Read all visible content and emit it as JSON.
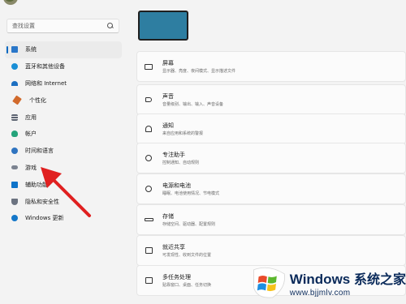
{
  "search": {
    "placeholder": "查找设置"
  },
  "sidebar": {
    "items": [
      {
        "label": "系统",
        "icon": "system-icon",
        "active": true
      },
      {
        "label": "蓝牙和其他设备",
        "icon": "bluetooth-icon"
      },
      {
        "label": "网络和 Internet",
        "icon": "wifi-icon"
      },
      {
        "label": "个性化",
        "icon": "brush-icon"
      },
      {
        "label": "应用",
        "icon": "apps-icon"
      },
      {
        "label": "帐户",
        "icon": "account-icon"
      },
      {
        "label": "时间和语言",
        "icon": "globe-clock-icon"
      },
      {
        "label": "游戏",
        "icon": "gamepad-icon"
      },
      {
        "label": "辅助功能",
        "icon": "accessibility-icon"
      },
      {
        "label": "隐私和安全性",
        "icon": "shield-icon"
      },
      {
        "label": "Windows 更新",
        "icon": "update-icon"
      }
    ]
  },
  "cards": [
    {
      "title": "屏幕",
      "subtitle": "显示器、亮度、夜间模式、显示描述文件",
      "icon": "display-icon"
    },
    {
      "title": "声音",
      "subtitle": "音量级别、输出、输入、声音设备",
      "icon": "speaker-icon"
    },
    {
      "title": "通知",
      "subtitle": "来自应用和系统的警报",
      "icon": "bell-icon"
    },
    {
      "title": "专注助手",
      "subtitle": "控制通知、自动规则",
      "icon": "moon-icon"
    },
    {
      "title": "电源和电池",
      "subtitle": "睡眠、电池使用情况、节电模式",
      "icon": "power-icon"
    },
    {
      "title": "存储",
      "subtitle": "存储空间、驱动器、配置规则",
      "icon": "storage-icon"
    },
    {
      "title": "就近共享",
      "subtitle": "可发现性、收到文件的位置",
      "icon": "share-icon"
    },
    {
      "title": "多任务处理",
      "subtitle": "贴靠窗口、桌面、任务切换",
      "icon": "multitask-icon"
    }
  ],
  "watermark": {
    "brand": "Windows",
    "cn": "系统之家",
    "url": "www.bjjmlv.com"
  },
  "colors": {
    "accent": "#0067c0",
    "arrow": "#e02020",
    "background": "#f3f3f3"
  }
}
